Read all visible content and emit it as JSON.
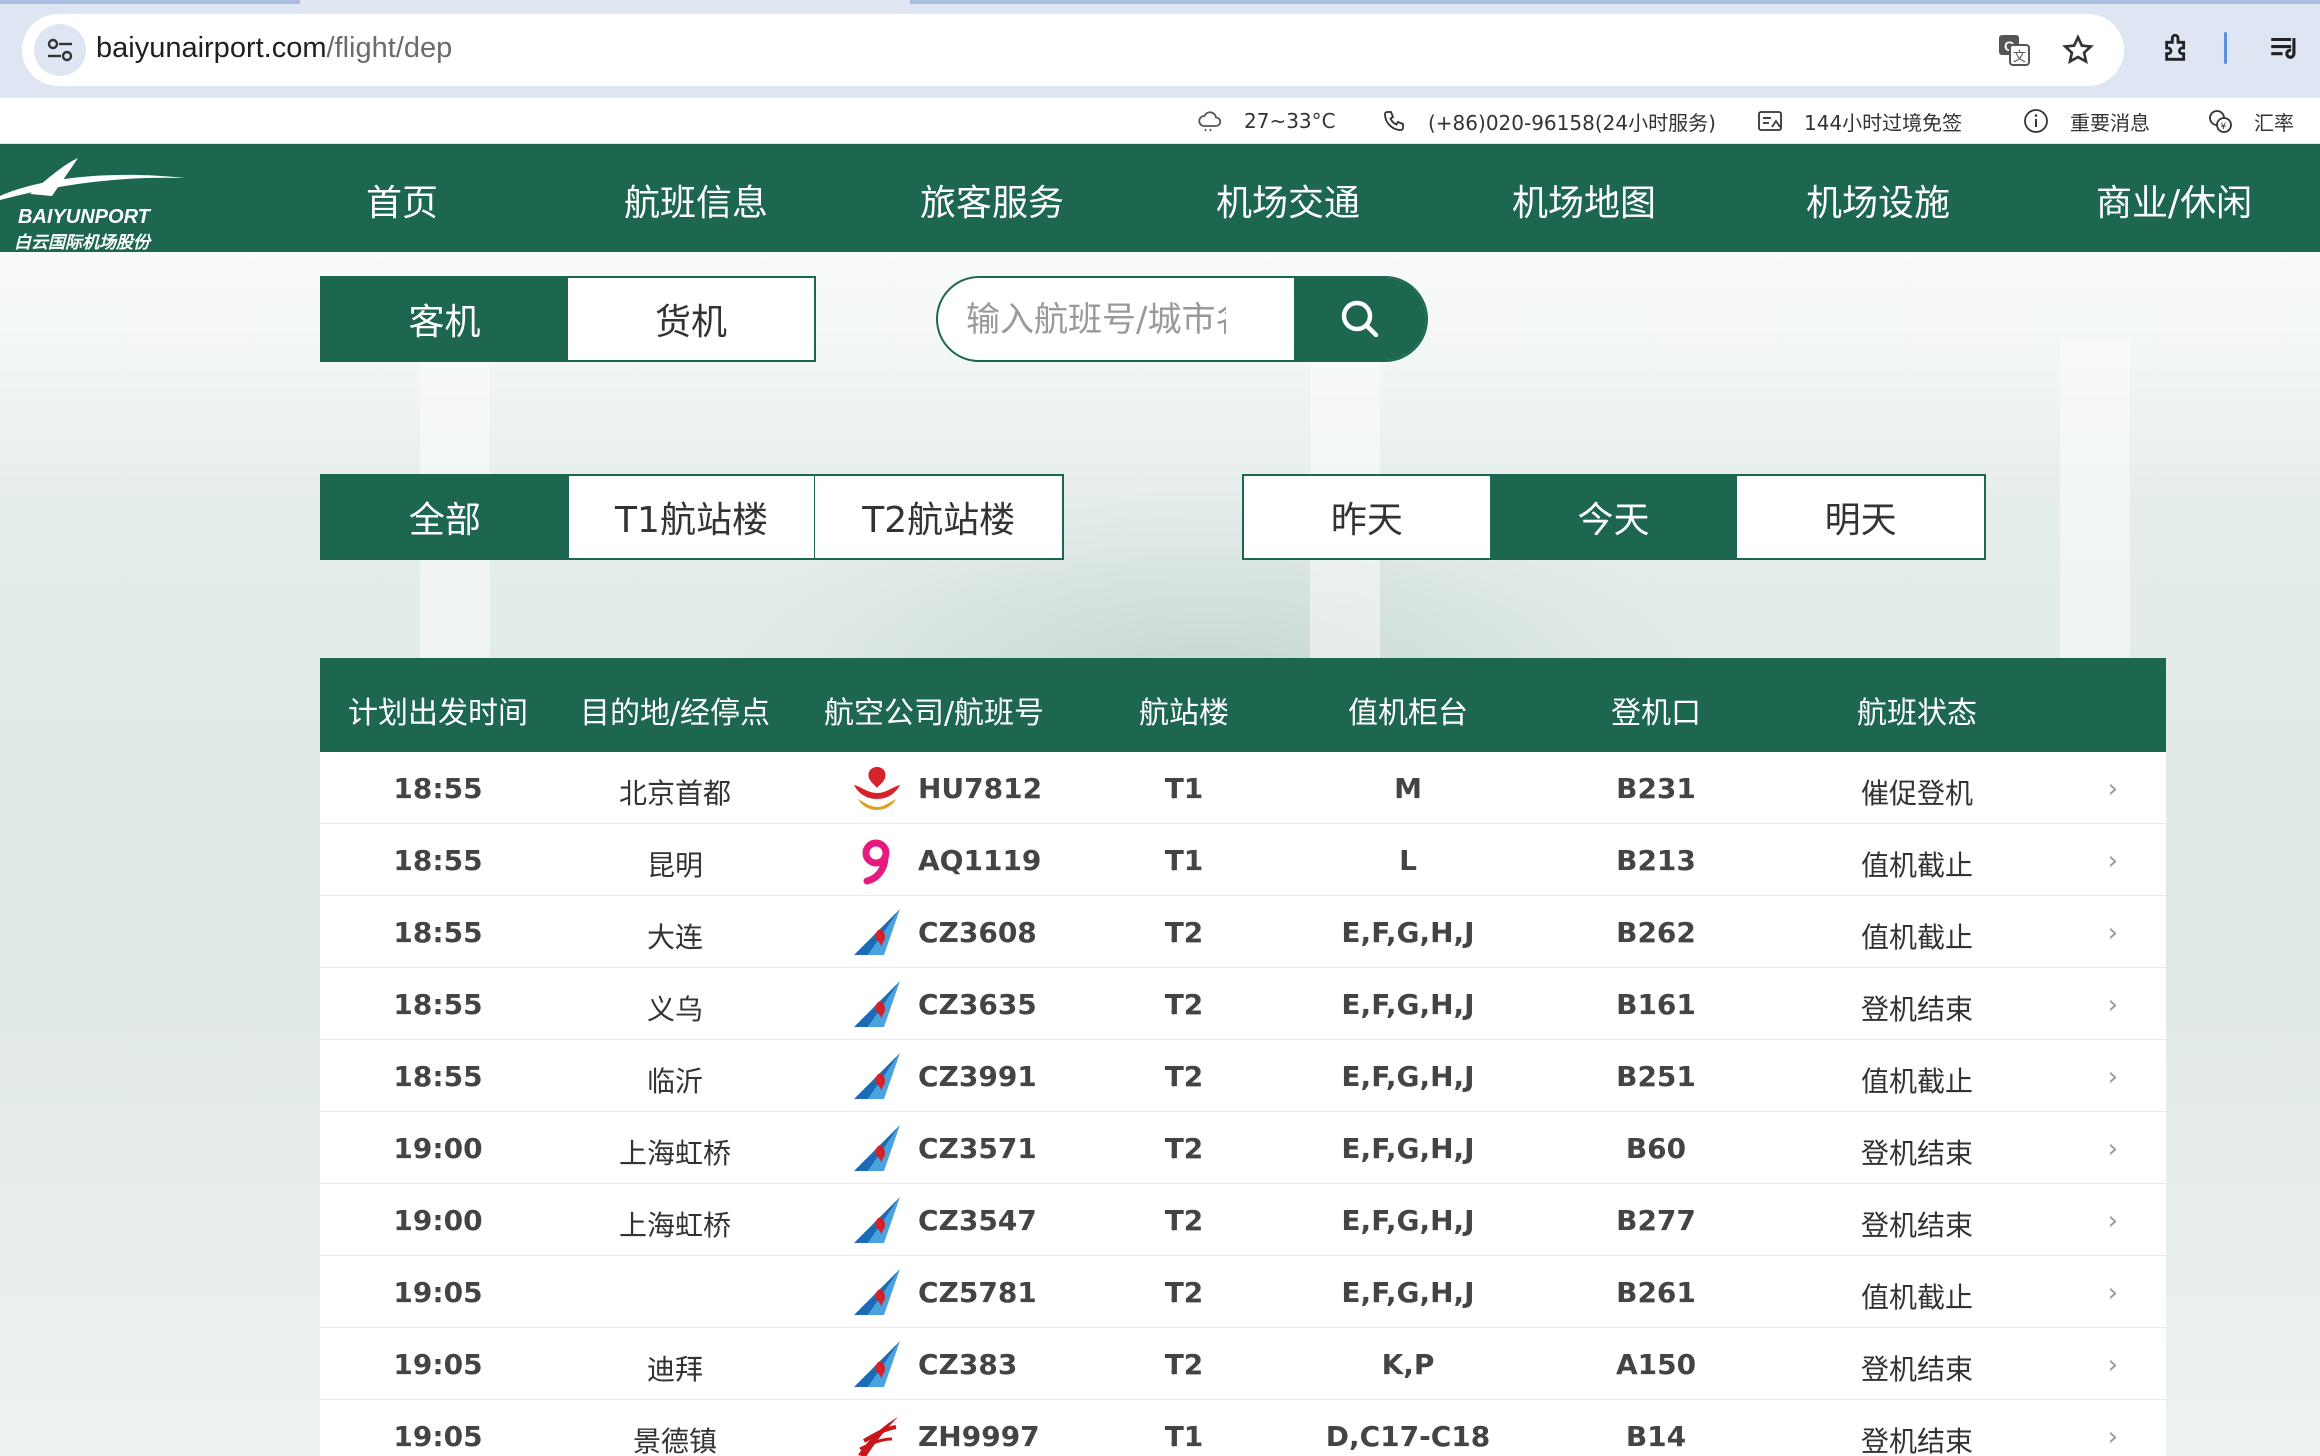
{
  "browser": {
    "url_host": "baiyunairport.com",
    "url_path": "/flight/dep"
  },
  "utility_bar": {
    "weather": "27~33°C",
    "phone": "(+86)020-96158(24小时服务)",
    "visa": "144小时过境免签",
    "notice": "重要消息",
    "exchange": "汇率"
  },
  "nav": {
    "logo_en": "BAIYUNPORT",
    "logo_cn": "白云国际机场股份",
    "items": [
      "首页",
      "航班信息",
      "旅客服务",
      "机场交通",
      "机场地图",
      "机场设施",
      "商业/休闲"
    ]
  },
  "filters": {
    "type": {
      "options": [
        "客机",
        "货机"
      ],
      "active": 0
    },
    "search_placeholder": "输入航班号/城市名",
    "terminal": {
      "options": [
        "全部",
        "T1航站楼",
        "T2航站楼"
      ],
      "active": 0
    },
    "day": {
      "options": [
        "昨天",
        "今天",
        "明天"
      ],
      "active": 1
    }
  },
  "table": {
    "headers": [
      "计划出发时间",
      "目的地/经停点",
      "航空公司/航班号",
      "航站楼",
      "值机柜台",
      "登机口",
      "航班状态"
    ],
    "rows": [
      {
        "time": "18:55",
        "dest": "北京首都",
        "airline": "hainan",
        "flight": "HU7812",
        "terminal": "T1",
        "counter": "M",
        "gate": "B231",
        "status": "催促登机"
      },
      {
        "time": "18:55",
        "dest": "昆明",
        "airline": "9air",
        "flight": "AQ1119",
        "terminal": "T1",
        "counter": "L",
        "gate": "B213",
        "status": "值机截止"
      },
      {
        "time": "18:55",
        "dest": "大连",
        "airline": "csair",
        "flight": "CZ3608",
        "terminal": "T2",
        "counter": "E,F,G,H,J",
        "gate": "B262",
        "status": "值机截止"
      },
      {
        "time": "18:55",
        "dest": "义乌",
        "airline": "csair",
        "flight": "CZ3635",
        "terminal": "T2",
        "counter": "E,F,G,H,J",
        "gate": "B161",
        "status": "登机结束"
      },
      {
        "time": "18:55",
        "dest": "临沂",
        "airline": "csair",
        "flight": "CZ3991",
        "terminal": "T2",
        "counter": "E,F,G,H,J",
        "gate": "B251",
        "status": "值机截止"
      },
      {
        "time": "19:00",
        "dest": "上海虹桥",
        "airline": "csair",
        "flight": "CZ3571",
        "terminal": "T2",
        "counter": "E,F,G,H,J",
        "gate": "B60",
        "status": "登机结束"
      },
      {
        "time": "19:00",
        "dest": "上海虹桥",
        "airline": "csair",
        "flight": "CZ3547",
        "terminal": "T2",
        "counter": "E,F,G,H,J",
        "gate": "B277",
        "status": "登机结束"
      },
      {
        "time": "19:05",
        "dest": "",
        "airline": "csair",
        "flight": "CZ5781",
        "terminal": "T2",
        "counter": "E,F,G,H,J",
        "gate": "B261",
        "status": "值机截止"
      },
      {
        "time": "19:05",
        "dest": "迪拜",
        "airline": "csair",
        "flight": "CZ383",
        "terminal": "T2",
        "counter": "K,P",
        "gate": "A150",
        "status": "登机结束"
      },
      {
        "time": "19:05",
        "dest": "景德镇",
        "airline": "shenzhen",
        "flight": "ZH9997",
        "terminal": "T1",
        "counter": "D,C17-C18",
        "gate": "B14",
        "status": "登机结束"
      }
    ]
  },
  "colors": {
    "brand_green": "#1d6650",
    "hainan_red": "#d4232b",
    "nineair_pink": "#e6197f",
    "csair_blue": "#1a6bb8",
    "csair_red": "#d1232a",
    "shenzhen_red": "#c8161d"
  }
}
